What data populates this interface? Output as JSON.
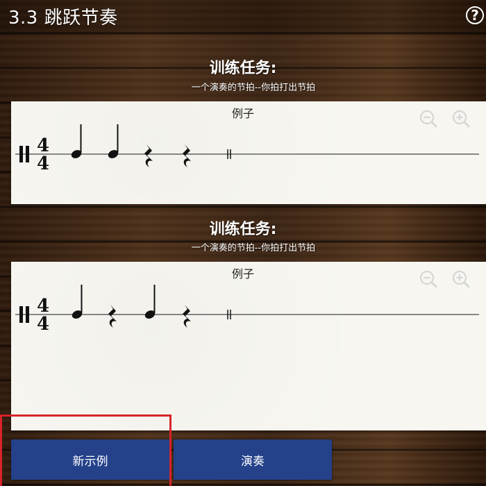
{
  "header": {
    "title": "3.3 跳跃节奏",
    "help_icon": "help-icon"
  },
  "exercises": [
    {
      "task_title": "训练任务:",
      "task_desc": "一个演奏的节拍--你拍打出节拍",
      "panel_label": "例子",
      "time_signature": {
        "top": "4",
        "bottom": "4"
      },
      "notes": [
        "quarter",
        "quarter",
        "quarter-rest",
        "quarter-rest"
      ]
    },
    {
      "task_title": "训练任务:",
      "task_desc": "一个演奏的节拍--你拍打出节拍",
      "panel_label": "例子",
      "time_signature": {
        "top": "4",
        "bottom": "4"
      },
      "notes": [
        "quarter",
        "quarter-rest",
        "quarter",
        "quarter-rest"
      ]
    }
  ],
  "controls": {
    "zoom_out_icon": "zoom-out-icon",
    "zoom_in_icon": "zoom-in-icon",
    "icon_color": "#d6d6d6"
  },
  "buttons": {
    "new_example": "新示例",
    "play": "演奏"
  },
  "colors": {
    "button": "#24418a",
    "highlight": "#d8232a"
  }
}
